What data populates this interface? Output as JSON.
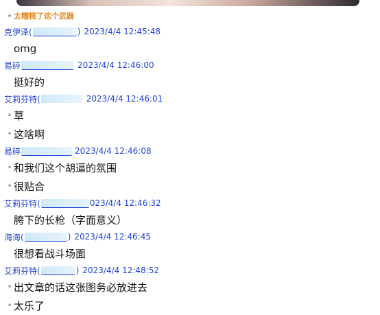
{
  "chat": {
    "caption": "太糟糕了这个武器",
    "blocks": [
      {
        "name": "克伊泽(",
        "close": ")",
        "time": "2023/4/4 12:45:48",
        "messages": [
          "omg"
        ]
      },
      {
        "name": "易碎",
        "close": "",
        "time": "2023/4/4 12:46:00",
        "messages": [
          "挺好的"
        ]
      },
      {
        "name": "艾莉芬特(",
        "close": "",
        "time": "2023/4/4 12:46:01",
        "messages": [
          "草",
          "这啥啊"
        ]
      },
      {
        "name": "易碎",
        "close": "",
        "time": "2023/4/4 12:46:08",
        "messages": [
          "和我们这个胡逼的氛围",
          "很贴合"
        ]
      },
      {
        "name": "艾莉芬特(",
        "close": "",
        "time": "023/4/4 12:46:32",
        "messages": [
          "胯下的长枪（字面意义）"
        ]
      },
      {
        "name": "海海(",
        "close": ")",
        "time": "2023/4/4 12:46:45",
        "messages": [
          "很想看战斗场面"
        ]
      },
      {
        "name": "艾莉芬特(",
        "close": ")",
        "time": "2023/4/4 12:48:52",
        "messages": [
          "出文章的话这张图务必放进去",
          "太乐了"
        ]
      }
    ]
  }
}
